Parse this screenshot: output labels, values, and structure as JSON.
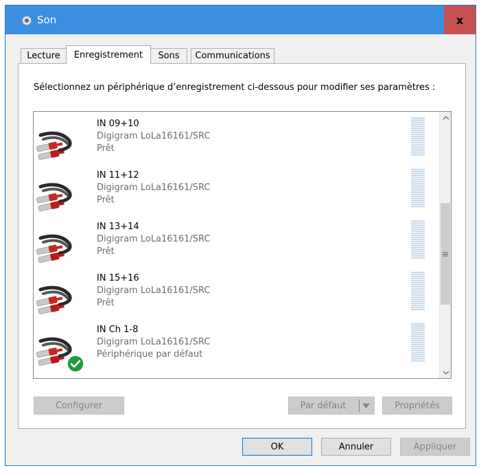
{
  "window": {
    "title": "Son",
    "close_label": "x"
  },
  "tabs": [
    {
      "label": "Lecture",
      "active": false
    },
    {
      "label": "Enregistrement",
      "active": true
    },
    {
      "label": "Sons",
      "active": false
    },
    {
      "label": "Communications",
      "active": false
    }
  ],
  "instruction": "Sélectionnez un périphérique d’enregistrement ci-dessous pour modifier ses paramètres :",
  "devices": [
    {
      "name": "IN 09+10",
      "driver": "Digigram LoLa16161/SRC",
      "status": "Prêt",
      "is_default": false
    },
    {
      "name": "IN 11+12",
      "driver": "Digigram LoLa16161/SRC",
      "status": "Prêt",
      "is_default": false
    },
    {
      "name": "IN 13+14",
      "driver": "Digigram LoLa16161/SRC",
      "status": "Prêt",
      "is_default": false
    },
    {
      "name": "IN 15+16",
      "driver": "Digigram LoLa16161/SRC",
      "status": "Prêt",
      "is_default": false
    },
    {
      "name": "IN Ch 1-8",
      "driver": "Digigram LoLa16161/SRC",
      "status": "Périphérique par défaut",
      "is_default": true
    }
  ],
  "panel_buttons": {
    "configure": "Configurer",
    "set_default": "Par défaut",
    "properties": "Propriétés"
  },
  "dialog_buttons": {
    "ok": "OK",
    "cancel": "Annuler",
    "apply": "Appliquer"
  },
  "colors": {
    "titlebar": "#3c8fe0",
    "close": "#c75050",
    "default_check": "#1e9e3a"
  }
}
